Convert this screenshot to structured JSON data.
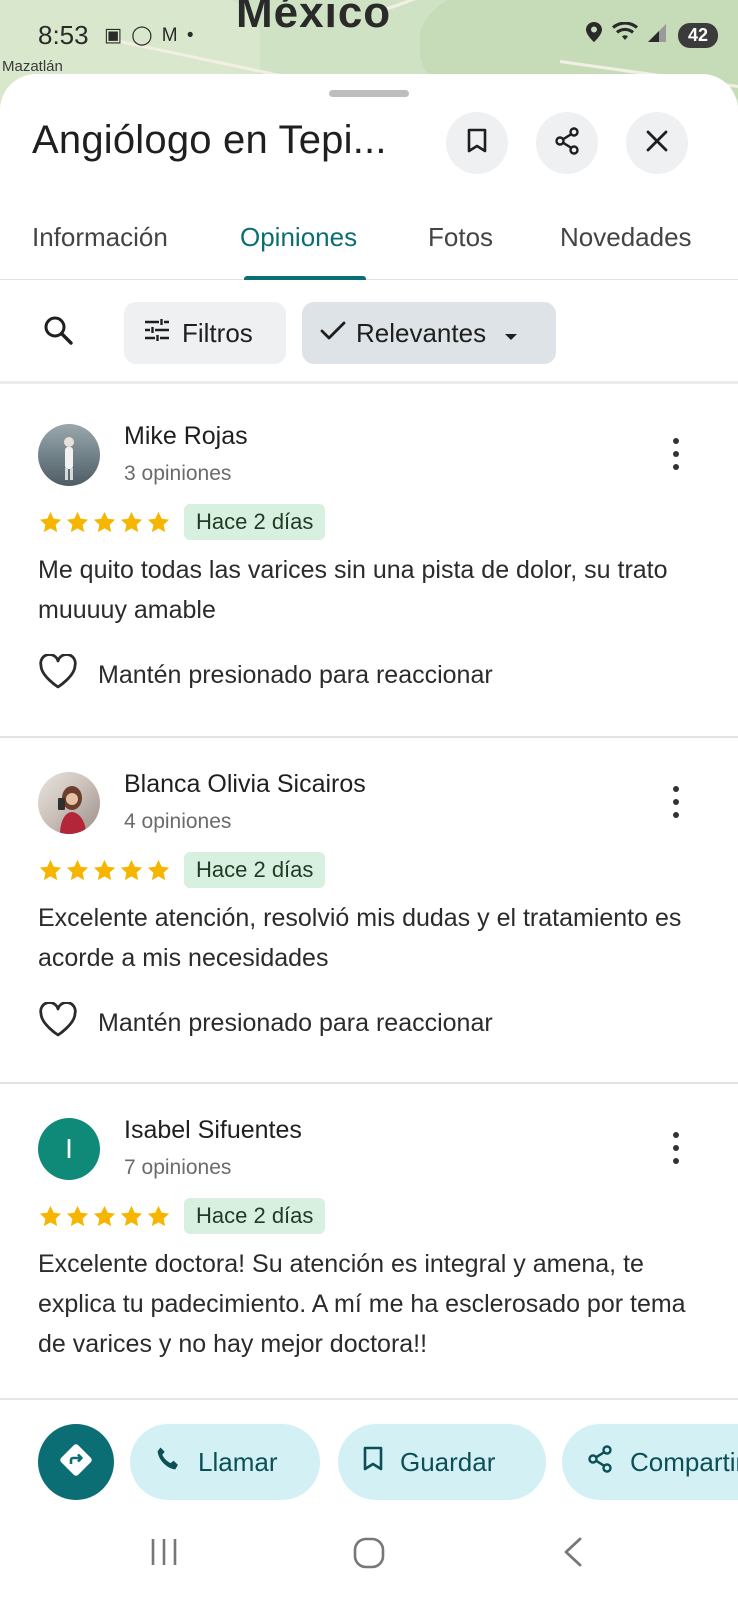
{
  "map": {
    "country": "México",
    "city": "Mazatlán"
  },
  "status_bar": {
    "time": "8:53",
    "notification_icons": "▣ ◯ M •",
    "battery": "42"
  },
  "place": {
    "title": "Angiólogo en Tepi..."
  },
  "tabs": [
    {
      "label": "Información"
    },
    {
      "label": "Opiniones"
    },
    {
      "label": "Fotos"
    },
    {
      "label": "Novedades"
    }
  ],
  "filters": {
    "filtros_label": "Filtros",
    "sort_label": "Relevantes"
  },
  "reviews": [
    {
      "name": "Mike Rojas",
      "count": "3 opiniones",
      "stars": 5,
      "date": "Hace 2 días",
      "text": "Me quito todas las varices sin una pista de dolor, su trato muuuuy amable",
      "react": "Mantén presionado para reaccionar"
    },
    {
      "name": "Blanca Olivia Sicairos",
      "count": "4 opiniones",
      "stars": 5,
      "date": "Hace 2 días",
      "text": "Excelente atención, resolvió mis dudas y el tratamiento es acorde a mis necesidades",
      "react": "Mantén presionado para reaccionar"
    },
    {
      "name": "Isabel Sifuentes",
      "initial": "I",
      "count": "7 opiniones",
      "stars": 5,
      "date": "Hace 2 días",
      "text": "Excelente doctora! Su atención es integral y amena, te explica tu padecimiento. A mí me ha esclerosado por tema de varices y no hay mejor doctora!!"
    }
  ],
  "actions": {
    "call": "Llamar",
    "save": "Guardar",
    "share": "Compartir"
  },
  "colors": {
    "accent": "#0b6e74",
    "star": "#f6b600",
    "badge_bg": "#d7f0df",
    "pill_bg": "#d3f0f5"
  }
}
